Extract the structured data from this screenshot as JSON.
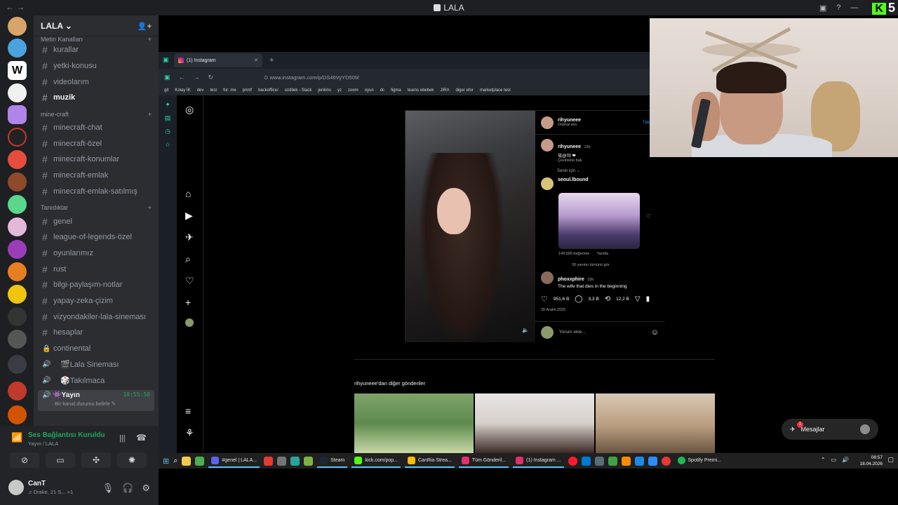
{
  "window": {
    "title": "LALA",
    "nav": "← →",
    "kick_logo": "K",
    "kick_num": "5"
  },
  "server": {
    "name": "LALA ⌄",
    "categories": {
      "c0": "Metin Kanalları",
      "c1": "mine-craft",
      "c2": "Tanıdıklar"
    }
  },
  "channels": {
    "top": [
      "kurallar",
      "yetki-konusu",
      "videolarım",
      "muzik"
    ],
    "minecraft": [
      "minecraft-chat",
      "minecraft-özel",
      "minecraft-konumlar",
      "minecraft-emlak",
      "minecraft-emlak-satılmış"
    ],
    "tanidiklar": [
      "genel",
      "league-of-legends-özel",
      "oyunlarımız",
      "rust",
      "bilgi-paylaşım-notlar",
      "yapay-zeka-çizim",
      "vizyondakiler-lala-sineması",
      "hesaplar"
    ],
    "locked": "continental",
    "voice": [
      "🎬Lala Sineması",
      "🎲Takılmaca"
    ],
    "live": {
      "name": "👾Yayın",
      "time": "10:55:50",
      "status": "Bir kanal durumu belirle ✎"
    }
  },
  "voice": {
    "status": "Ses Bağlantısı Kuruldu",
    "sub": "Yayın / LALA"
  },
  "user": {
    "name": "CanT",
    "status": "♫ Drake, 21 S...",
    "extra": "+1"
  },
  "browser": {
    "tab_title": "(1) Instagram",
    "url": "www.instagram.com/p/DS46VyYD509/",
    "bookmarks": [
      "git",
      "Kolay İK",
      "dev",
      "test",
      "for: me",
      "printf",
      "backoffice/",
      "ozdilek - Slack",
      "jenkins",
      "yz",
      "zoom",
      "oyun",
      "dc",
      "figma",
      "teams ebebek",
      "JIRA",
      "diger efor",
      "marketplace test"
    ]
  },
  "post": {
    "author": "rihyuneee",
    "audio": "Orijinal ses",
    "follow": "Takip Et",
    "caption_author": "rihyuneee",
    "caption_time": "15h",
    "caption": "뭐@야 ❤",
    "translate": "Çevirisine bak",
    "sort": "Senin için ⌄",
    "comment1_author": "seoul.lbound",
    "comment1_likes": "149.690 beğenme",
    "comment1_reply": "Yanıtla",
    "comment1_more": "30 yanıtın tümünü gör",
    "comment2_author": "phoxxphire",
    "comment2_time": "15h",
    "comment2_text": "The wife that dies in the beginning",
    "likes": "951,6 B",
    "comments": "3,3 B",
    "reposts": "12,2 B",
    "date": "30 Aralık 2025",
    "input_placeholder": "Yorum ekle..."
  },
  "more_posts": "rihyuneee'dan diğer gönderiler",
  "messages": "Mesajlar",
  "notif_badge": "1",
  "taskbar": {
    "apps": [
      "#genel | LALA...",
      "Steam",
      "kick.com/pop...",
      "CanRia Strea...",
      "Tüm Gönderil...",
      "(1) Instagram ...",
      "Spotify Premi..."
    ],
    "time": "08:57",
    "date": "18.04.2026"
  }
}
